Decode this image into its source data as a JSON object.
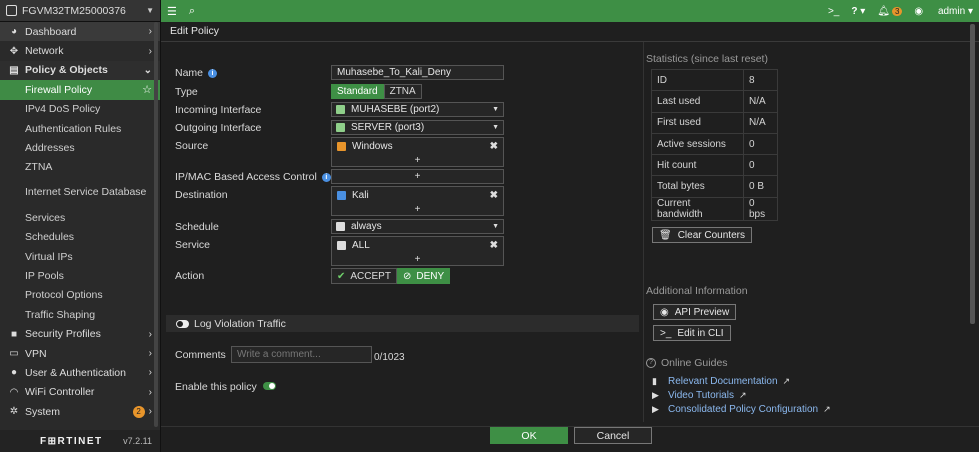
{
  "device": {
    "name": "FGVM32TM25000376"
  },
  "sidebar": {
    "items": [
      {
        "label": "Dashboard",
        "icon": "dashboard-icon",
        "glyph": "◕",
        "chev": "›"
      },
      {
        "label": "Network",
        "icon": "network-icon",
        "glyph": "✥",
        "chev": "›"
      },
      {
        "label": "Policy & Objects",
        "icon": "policy-icon",
        "glyph": "▤",
        "chev": "⌄"
      },
      {
        "label": "Firewall Policy"
      },
      {
        "label": "IPv4 DoS Policy"
      },
      {
        "label": "Authentication Rules"
      },
      {
        "label": "Addresses"
      },
      {
        "label": "ZTNA"
      },
      {
        "label": "Internet Service Database"
      },
      {
        "label": "Services"
      },
      {
        "label": "Schedules"
      },
      {
        "label": "Virtual IPs"
      },
      {
        "label": "IP Pools"
      },
      {
        "label": "Protocol Options"
      },
      {
        "label": "Traffic Shaping"
      },
      {
        "label": "Security Profiles",
        "icon": "lock-icon",
        "glyph": "🔒",
        "chev": "›"
      },
      {
        "label": "VPN",
        "icon": "monitor-icon",
        "glyph": "▭",
        "chev": "›"
      },
      {
        "label": "User & Authentication",
        "icon": "user-icon",
        "glyph": "●",
        "chev": "›"
      },
      {
        "label": "WiFi Controller",
        "icon": "wifi-icon",
        "glyph": "◠",
        "chev": "›"
      },
      {
        "label": "System",
        "icon": "gear-icon",
        "glyph": "✲",
        "chev": "›",
        "badge": "2"
      }
    ]
  },
  "brand": {
    "logo": "F⊞RTINET",
    "version": "v7.2.11"
  },
  "topbar": {
    "cli": ">_",
    "help": "?",
    "bell_count": "3",
    "user": "admin"
  },
  "page": {
    "title": "Edit Policy"
  },
  "form": {
    "name_label": "Name",
    "name_value": "Muhasebe_To_Kali_Deny",
    "type_label": "Type",
    "type_options": [
      "Standard",
      "ZTNA"
    ],
    "incoming_label": "Incoming Interface",
    "incoming_value": "MUHASEBE (port2)",
    "outgoing_label": "Outgoing Interface",
    "outgoing_value": "SERVER (port3)",
    "source_label": "Source",
    "source_value": "Windows",
    "ipmac_label": "IP/MAC Based Access Control",
    "destination_label": "Destination",
    "destination_value": "Kali",
    "schedule_label": "Schedule",
    "schedule_value": "always",
    "service_label": "Service",
    "service_value": "ALL",
    "action_label": "Action",
    "action_accept": "ACCEPT",
    "action_deny": "DENY",
    "log_violation_label": "Log Violation Traffic",
    "comments_label": "Comments",
    "comments_placeholder": "Write a comment...",
    "comments_count": "0/1023",
    "enable_label": "Enable this policy",
    "plus": "+",
    "remove": "✖"
  },
  "stats": {
    "heading": "Statistics (since last reset)",
    "rows": [
      {
        "k": "ID",
        "v": "8"
      },
      {
        "k": "Last used",
        "v": "N/A"
      },
      {
        "k": "First used",
        "v": "N/A"
      },
      {
        "k": "Active sessions",
        "v": "0"
      },
      {
        "k": "Hit count",
        "v": "0"
      },
      {
        "k": "Total bytes",
        "v": "0 B"
      },
      {
        "k": "Current bandwidth",
        "v": "0 bps"
      }
    ],
    "clear_label": "Clear Counters"
  },
  "additional": {
    "heading": "Additional Information",
    "api_preview": "API Preview",
    "edit_cli": "Edit in CLI"
  },
  "guides": {
    "heading": "Online Guides",
    "links": [
      "Relevant Documentation",
      "Video Tutorials",
      "Consolidated Policy Configuration"
    ]
  },
  "footer": {
    "ok": "OK",
    "cancel": "Cancel"
  },
  "colors": {
    "accent": "#3e8f45",
    "warning": "#e8952b",
    "link": "#8bb8ee"
  }
}
